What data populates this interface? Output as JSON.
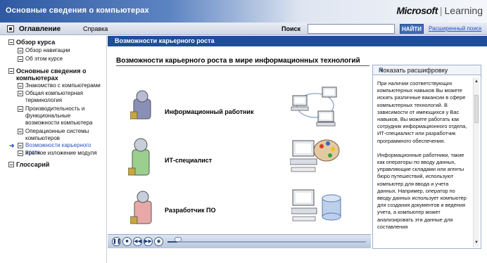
{
  "window": {
    "title": "Основные сведения о компьютерах",
    "brand": "Microsoft",
    "brand_product": "Learning"
  },
  "menu": {
    "toc_label": "Оглавление",
    "help_label": "Справка",
    "search_label": "Поиск",
    "search_value": "",
    "find_button": "НАЙТИ",
    "advanced_search": "Расширенный поиск"
  },
  "sidebar": {
    "items": [
      {
        "label": "Обзор курса",
        "level": "section",
        "active": false
      },
      {
        "label": "Обзор навигации",
        "level": "item",
        "active": false
      },
      {
        "label": "Об этом курсе",
        "level": "item",
        "active": false
      },
      {
        "label": "Основные сведения о компьютерах",
        "level": "section",
        "active": false
      },
      {
        "label": "Знакомство с компьютерами",
        "level": "item",
        "active": false
      },
      {
        "label": "Общая компьютерная терминология",
        "level": "item",
        "active": false
      },
      {
        "label": "Производительность и функциональные возможности компьютера",
        "level": "item",
        "active": false
      },
      {
        "label": "Операционные системы компьютеров",
        "level": "item",
        "active": false
      },
      {
        "label": "Возможности карьерного роста",
        "level": "item",
        "active": true
      },
      {
        "label": "Краткое изложение модуля",
        "level": "item",
        "active": false
      },
      {
        "label": "Глоссарий",
        "level": "section",
        "active": false
      }
    ]
  },
  "content": {
    "section_title": "Возможности карьерного роста",
    "page_title": "Возможности карьерного роста в мире информационных технологий",
    "roles": [
      {
        "label": "Информационный работник",
        "person_color": "#8a8fb8",
        "illustration": "network-icon"
      },
      {
        "label": "ИТ-специалист",
        "person_color": "#9bcf8d",
        "illustration": "palette-icon"
      },
      {
        "label": "Разработчик ПО",
        "person_color": "#e9a8a8",
        "illustration": "database-icon"
      }
    ]
  },
  "transcript": {
    "header": "Показать расшифровку",
    "paragraphs": [
      "При наличии соответствующих компьютерных навыков Вы можете искать различные вакансии в сфере компьютерных технологий. В зависимости от имеющихся у Вас навыков, Вы можете работать как сотрудник информационного отдела, ИТ-специалист или разработчик программного обеспечения.",
      "Информационные работники, такие как операторы по вводу данных, управляющие складами или агенты бюро путешествий, используют компьютер для ввода и учета данных. Например, оператор по вводу данных использует компьютер для создания документов и ведения учета, а компьютер может анализировать эти данные для составления"
    ]
  },
  "media": {
    "controls": [
      "pause-icon",
      "stop-icon",
      "rewind-icon",
      "forward-icon",
      "volume-icon"
    ],
    "progress": 0.05
  },
  "colors": {
    "title_bar": "#2f5aa3",
    "content_bar": "#1e4e9a",
    "link": "#2a52c8"
  }
}
